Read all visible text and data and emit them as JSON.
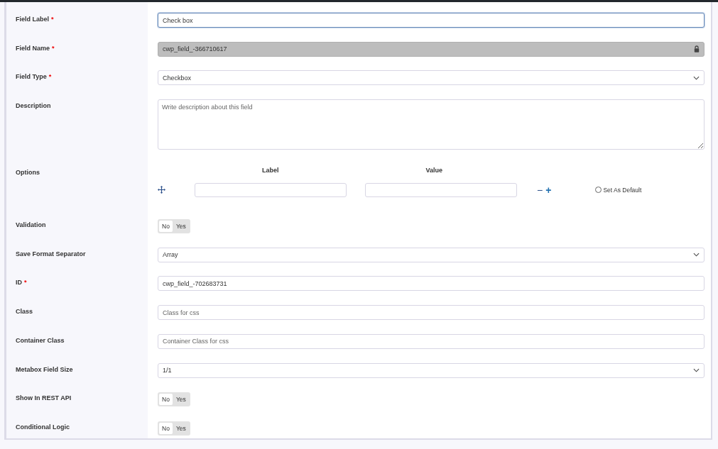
{
  "fields": [
    {
      "kind": "text",
      "label": "Field Label",
      "required_mark": "*",
      "value": "Check box",
      "focused": true
    },
    {
      "kind": "locked",
      "label": "Field Name",
      "required_mark": "*",
      "value": "cwp_field_-366710617"
    },
    {
      "kind": "select",
      "label": "Field Type",
      "required_mark": "*",
      "value": "Checkbox"
    },
    {
      "kind": "textarea",
      "label": "Description",
      "placeholder": "Write description about this field"
    },
    {
      "kind": "options",
      "label": "Options",
      "columns": [
        "Label",
        "Value"
      ],
      "rows": [
        {
          "remove": "−",
          "add": "+",
          "default_label": "Set As Default",
          "checked": false
        }
      ]
    },
    {
      "kind": "toggle",
      "label": "Validation",
      "options": [
        {
          "label": "No",
          "selected": true
        },
        {
          "label": "Yes",
          "selected": false
        }
      ]
    },
    {
      "kind": "select",
      "label": "Save Format Separator",
      "value": "Array"
    },
    {
      "kind": "text",
      "label": "ID",
      "required_mark": "*",
      "value": "cwp_field_-702683731",
      "focused": false
    },
    {
      "kind": "text",
      "label": "Class",
      "placeholder": "Class for css",
      "focused": false
    },
    {
      "kind": "text",
      "label": "Container Class",
      "placeholder": "Container Class for css",
      "focused": false
    },
    {
      "kind": "select",
      "label": "Metabox Field Size",
      "value": "1/1"
    },
    {
      "kind": "toggle",
      "label": "Show In REST API",
      "options": [
        {
          "label": "No",
          "selected": true
        },
        {
          "label": "Yes",
          "selected": false
        }
      ]
    },
    {
      "kind": "toggle",
      "label": "Conditional Logic",
      "options": [
        {
          "label": "No",
          "selected": true
        },
        {
          "label": "Yes",
          "selected": false
        }
      ]
    }
  ]
}
